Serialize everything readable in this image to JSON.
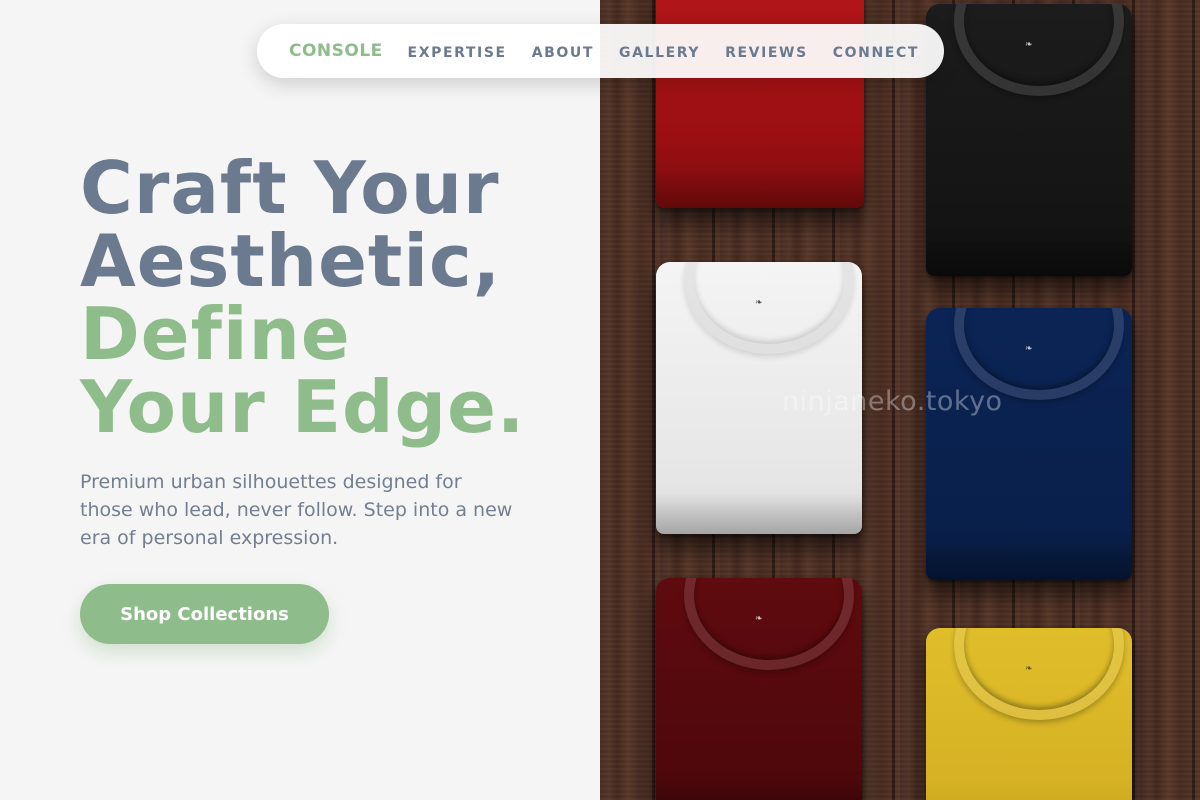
{
  "nav": {
    "brand": "CONSOLE",
    "links": [
      "EXPERTISE",
      "ABOUT",
      "GALLERY",
      "REVIEWS",
      "CONNECT"
    ]
  },
  "hero": {
    "headline_lines": [
      "Craft Your",
      "Aesthetic,",
      "Define",
      "Your Edge."
    ],
    "subtext": "Premium urban silhouettes designed for those who lead, never follow. Step into a new era of personal expression.",
    "cta_label": "Shop Collections"
  },
  "image": {
    "watermark": "ninjaneko.tokyo",
    "shirt_colors": [
      "red",
      "black",
      "white",
      "navy",
      "maroon",
      "yellow"
    ],
    "shirt_tag": "❧"
  },
  "colors": {
    "accent_sage": "#8fbc8b",
    "slate_text": "#6b7a8f",
    "background": "#f5f5f5"
  }
}
